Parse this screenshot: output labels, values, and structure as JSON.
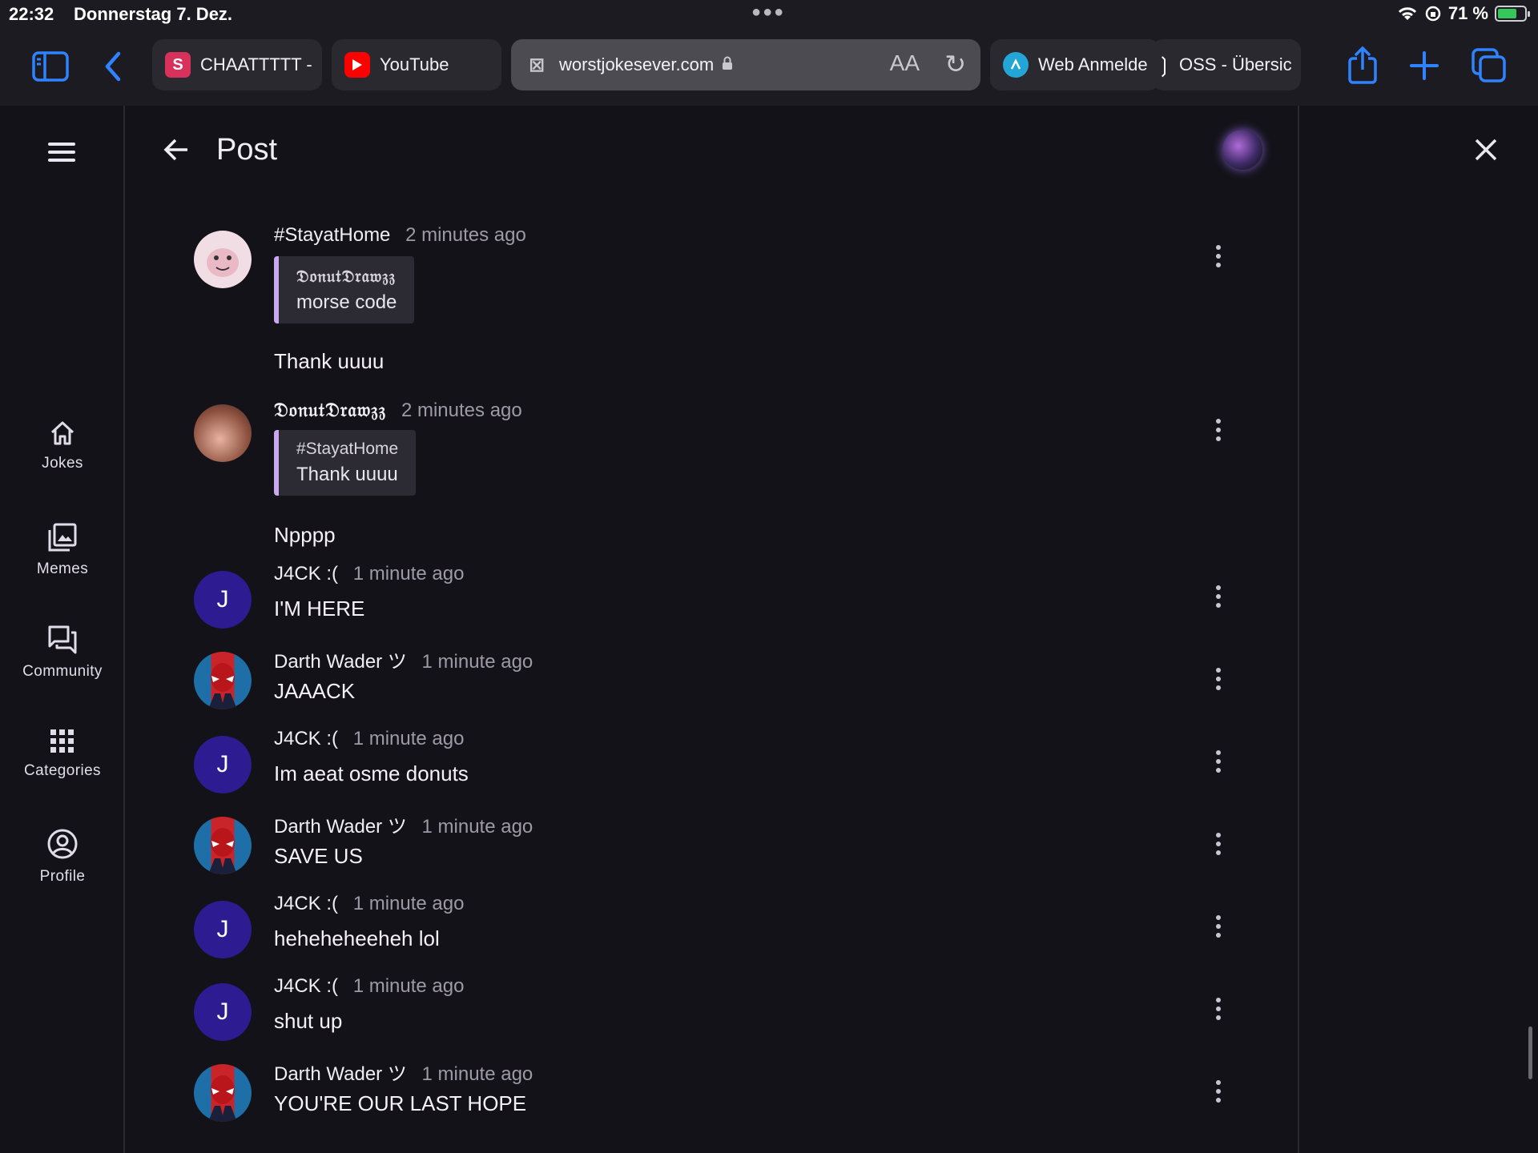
{
  "status": {
    "time": "22:32",
    "date": "Donnerstag 7. Dez.",
    "battery": "71 %",
    "battery_level": 0.71
  },
  "browser": {
    "tabs": [
      {
        "label": "CHAATTTTT -",
        "icon": "s-logo-icon",
        "color": "#d8315b"
      },
      {
        "label": "YouTube",
        "icon": "youtube-icon",
        "color": "#ff0000"
      },
      {
        "label": "worstjokesever.com",
        "icon": "close-tab-icon",
        "active": true
      },
      {
        "label": "Web Anmelde",
        "icon": "web-login-icon",
        "color": "#23a6d5"
      },
      {
        "label": "OSS - Übersic",
        "icon": "oss-icon"
      }
    ],
    "text_size_label": "AA"
  },
  "sidenav": {
    "items": [
      {
        "label": "Jokes",
        "icon": "home-icon"
      },
      {
        "label": "Memes",
        "icon": "gallery-icon"
      },
      {
        "label": "Community",
        "icon": "forum-icon"
      },
      {
        "label": "Categories",
        "icon": "grid-icon"
      },
      {
        "label": "Profile",
        "icon": "account-circle-icon"
      }
    ]
  },
  "appbar": {
    "title": "Post"
  },
  "comments": [
    {
      "author": "#StayatHome",
      "ago": "2 minutes ago",
      "avatar": "hamster",
      "quote": {
        "author": "𝔇𝔬𝔫𝔲𝔱𝔇𝔯𝔞𝔴𝔷𝔷",
        "text": "morse code"
      },
      "text": "Thank uuuu"
    },
    {
      "author": "𝔇𝔬𝔫𝔲𝔱𝔇𝔯𝔞𝔴𝔷𝔷",
      "ago": "2 minutes ago",
      "avatar": "donut",
      "quote": {
        "author": "#StayatHome",
        "text": "Thank uuuu"
      },
      "text": "Npppp"
    },
    {
      "author": "J4CK :(",
      "ago": "1 minute ago",
      "avatar": "J",
      "text": "I'M HERE"
    },
    {
      "author": "Darth Wader ツ",
      "ago": "1 minute ago",
      "avatar": "deadpool",
      "text": "JAAACK"
    },
    {
      "author": "J4CK :(",
      "ago": "1 minute ago",
      "avatar": "J",
      "text": "Im aeat osme donuts"
    },
    {
      "author": "Darth Wader ツ",
      "ago": "1 minute ago",
      "avatar": "deadpool",
      "text": "SAVE US"
    },
    {
      "author": "J4CK :(",
      "ago": "1 minute ago",
      "avatar": "J",
      "text": "heheheheeheh lol"
    },
    {
      "author": "J4CK :(",
      "ago": "1 minute ago",
      "avatar": "J",
      "text": "shut up"
    },
    {
      "author": "Darth Wader ツ",
      "ago": "1 minute ago",
      "avatar": "deadpool",
      "text": "YOU'RE OUR LAST HOPE"
    }
  ],
  "colors": {
    "accent": "#2f83ff",
    "background": "#131218",
    "quote_bar": "#c9a8f0",
    "j_avatar": "#2d1b91"
  }
}
